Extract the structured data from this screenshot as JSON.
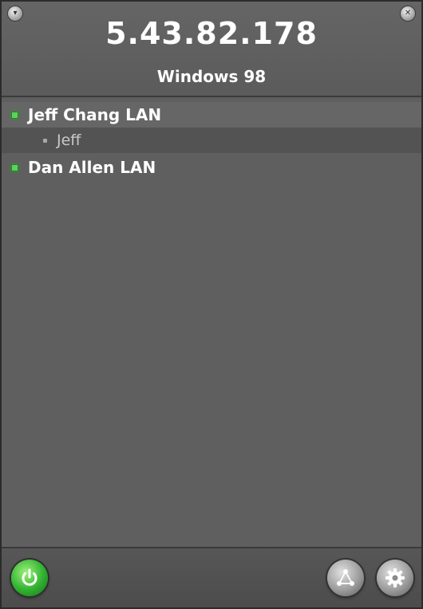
{
  "header": {
    "ip_address": "5.43.82.178",
    "os_name": "Windows 98",
    "left_corner_icon": "chevron-down-icon",
    "right_corner_icon": "close-icon"
  },
  "network_list": {
    "groups": [
      {
        "label": "Jeff Chang LAN",
        "status_color": "#5ad35a",
        "children": [
          {
            "label": "Jeff"
          }
        ]
      },
      {
        "label": "Dan Allen LAN",
        "status_color": "#5ad35a",
        "children": []
      }
    ]
  },
  "footer": {
    "power_icon": "power-icon",
    "network_icon": "network-icon",
    "settings_icon": "gear-icon"
  },
  "colors": {
    "background": "#5f5f5f",
    "status_online": "#5ad35a",
    "power_green": "#2fb12f"
  }
}
